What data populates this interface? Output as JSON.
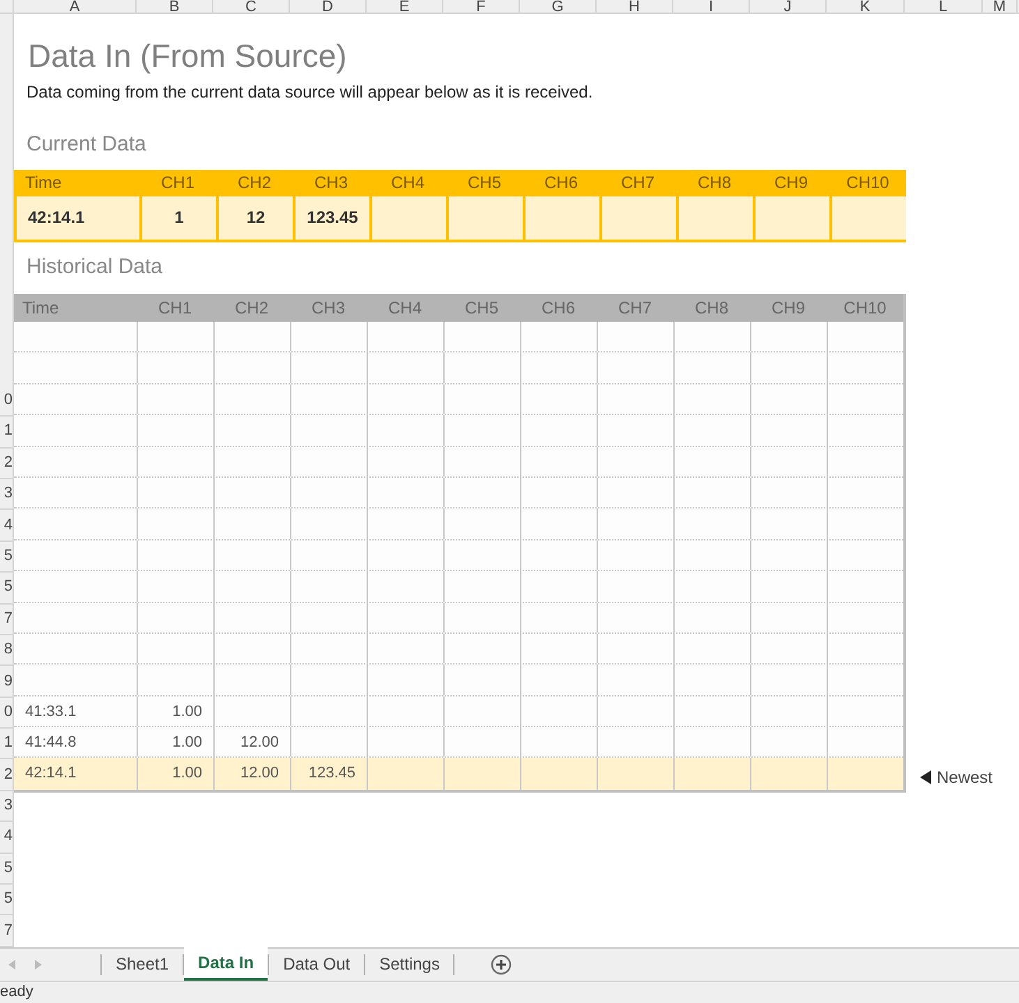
{
  "column_headers": [
    "A",
    "B",
    "C",
    "D",
    "E",
    "F",
    "G",
    "H",
    "I",
    "J",
    "K",
    "L",
    "M"
  ],
  "row_headers": [
    "0",
    "1",
    "2",
    "3",
    "4",
    "5",
    "5",
    "7",
    "8",
    "9",
    "0",
    "1",
    "2",
    "3",
    "4",
    "5",
    "5",
    "7"
  ],
  "title": "Data In (From Source)",
  "description": "Data coming from the current data source will appear below as it is received.",
  "current_data": {
    "heading": "Current Data",
    "columns": [
      "Time",
      "CH1",
      "CH2",
      "CH3",
      "CH4",
      "CH5",
      "CH6",
      "CH7",
      "CH8",
      "CH9",
      "CH10"
    ],
    "values": [
      "42:14.1",
      "1",
      "12",
      "123.45"
    ]
  },
  "historical_data": {
    "heading": "Historical Data",
    "columns": [
      "Time",
      "CH1",
      "CH2",
      "CH3",
      "CH4",
      "CH5",
      "CH6",
      "CH7",
      "CH8",
      "CH9",
      "CH10"
    ],
    "rows": [
      {
        "highlighted": false
      },
      {
        "highlighted": false
      },
      {
        "highlighted": false
      },
      {
        "highlighted": false
      },
      {
        "highlighted": false
      },
      {
        "highlighted": false
      },
      {
        "highlighted": false
      },
      {
        "highlighted": false
      },
      {
        "highlighted": false
      },
      {
        "highlighted": false
      },
      {
        "highlighted": false
      },
      {
        "highlighted": false
      },
      {
        "cells": [
          "41:33.1",
          "1.00"
        ],
        "highlighted": false
      },
      {
        "cells": [
          "41:44.8",
          "1.00",
          "12.00"
        ],
        "highlighted": false
      },
      {
        "cells": [
          "42:14.1",
          "1.00",
          "12.00",
          "123.45"
        ],
        "highlighted": true
      }
    ],
    "newest_label": "Newest"
  },
  "sheet_tabs": [
    {
      "label": "Sheet1",
      "selected": false
    },
    {
      "label": "Data In",
      "selected": true
    },
    {
      "label": "Data Out",
      "selected": false
    },
    {
      "label": "Settings",
      "selected": false
    }
  ],
  "status": "eady"
}
